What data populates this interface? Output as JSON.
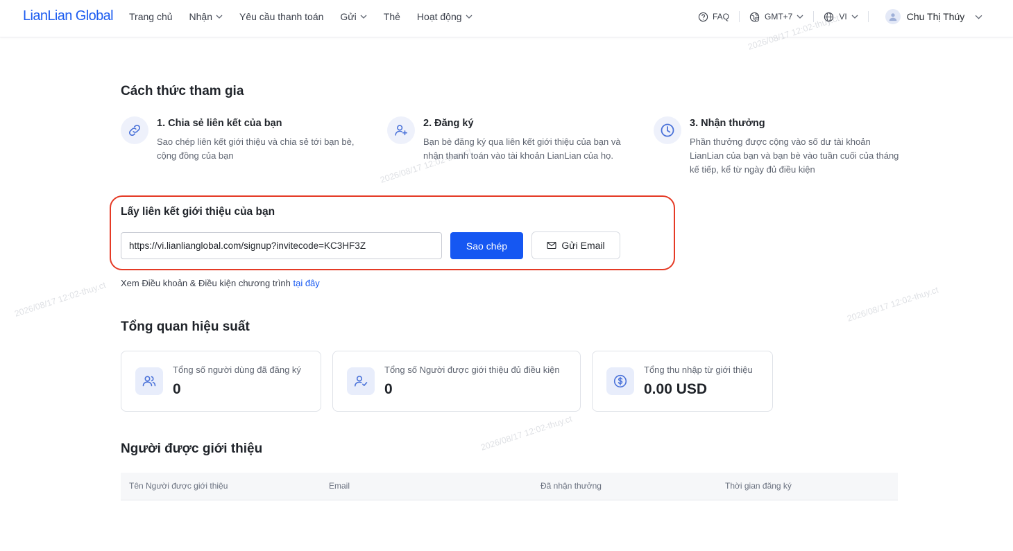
{
  "header": {
    "logo": "LianLian Global",
    "nav": [
      {
        "label": "Trang chủ",
        "has_dropdown": false
      },
      {
        "label": "Nhận",
        "has_dropdown": true
      },
      {
        "label": "Yêu cầu thanh toán",
        "has_dropdown": false
      },
      {
        "label": "Gửi",
        "has_dropdown": true
      },
      {
        "label": "Thẻ",
        "has_dropdown": false
      },
      {
        "label": "Hoạt động",
        "has_dropdown": true
      }
    ],
    "faq_label": "FAQ",
    "timezone_label": "GMT+7",
    "language_label": "VI",
    "user_name": "Chu Thị Thúy"
  },
  "how_to_join": {
    "title": "Cách thức tham gia",
    "steps": [
      {
        "icon": "link-icon",
        "title": "1. Chia sẻ liên kết của bạn",
        "desc": "Sao chép liên kết giới thiệu và chia sẻ tới bạn bè, cộng đồng của bạn"
      },
      {
        "icon": "user-add-icon",
        "title": "2. Đăng ký",
        "desc": "Bạn bè đăng ký qua liên kết giới thiệu của bạn và nhận thanh toán vào tài khoản LianLian của họ."
      },
      {
        "icon": "clock-icon",
        "title": "3. Nhận thưởng",
        "desc": "Phần thưởng được cộng vào số dư tài khoản LianLian của bạn và bạn bè vào tuần cuối của tháng kế tiếp, kể từ ngày đủ điều kiện"
      }
    ]
  },
  "referral_link": {
    "title": "Lấy liên kết giới thiệu của bạn",
    "url": "https://vi.lianlianglobal.com/signup?invitecode=KC3HF3Z",
    "copy_label": "Sao chép",
    "email_label": "Gửi Email",
    "terms_prefix": "Xem Điều khoản & Điều kiện chương trình",
    "terms_link": "tại đây",
    "highlight_color": "#e53a25"
  },
  "performance": {
    "title": "Tổng quan hiệu suất",
    "cards": [
      {
        "icon": "users-icon",
        "label": "Tổng số người dùng đã đăng ký",
        "value": "0"
      },
      {
        "icon": "user-check-icon",
        "label": "Tổng số Người được giới thiệu đủ điều kiện",
        "value": "0"
      },
      {
        "icon": "dollar-coin-icon",
        "label": "Tổng thu nhập từ giới thiệu",
        "value": "0.00 USD"
      }
    ]
  },
  "referrals_table": {
    "title": "Người được giới thiệu",
    "columns": [
      "Tên Người được giới thiệu",
      "Email",
      "Đã nhận thưởng",
      "Thời gian đăng ký"
    ]
  },
  "watermark": "2026/08/17 12:02-thuy.ct",
  "colors": {
    "accent": "#1557f2",
    "brand": "#1c5cf0"
  }
}
